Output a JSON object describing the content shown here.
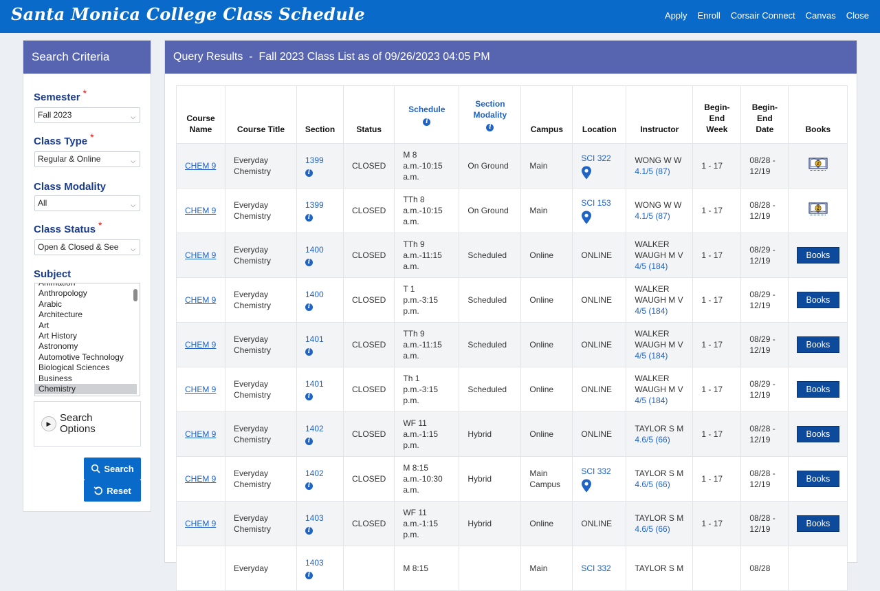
{
  "header": {
    "title": "Santa Monica College Class Schedule",
    "nav": [
      "Apply",
      "Enroll",
      "Corsair Connect",
      "Canvas",
      "Close"
    ]
  },
  "sidebar": {
    "title": "Search Criteria",
    "semester": {
      "label": "Semester",
      "required": "*",
      "value": "Fall 2023"
    },
    "class_type": {
      "label": "Class Type",
      "required": "*",
      "value": "Regular & Online"
    },
    "class_modality": {
      "label": "Class Modality",
      "value": "All"
    },
    "class_status": {
      "label": "Class Status",
      "required": "*",
      "value": "Open & Closed & See"
    },
    "subject": {
      "label": "Subject",
      "items": [
        "Animation",
        "Anthropology",
        "Arabic",
        "Architecture",
        "Art",
        "Art History",
        "Astronomy",
        "Automotive Technology",
        "Biological Sciences",
        "Business",
        "Chemistry"
      ],
      "selected": "Chemistry"
    },
    "search_options_label": "Search Options",
    "search_button": "Search",
    "reset_button": "Reset"
  },
  "results": {
    "title": "Query Results  -  Fall 2023 Class List as of 09/26/2023 04:05 PM",
    "columns": {
      "course_name": "Course Name",
      "course_title": "Course Title",
      "section": "Section",
      "status": "Status",
      "schedule": "Schedule",
      "modality": "Section Modality",
      "campus": "Campus",
      "location": "Location",
      "instructor": "Instructor",
      "begin_end_week": "Begin-End Week",
      "begin_end_date": "Begin-End Date",
      "books": "Books"
    },
    "rows": [
      {
        "course": "CHEM 9",
        "title": "Everyday Chemistry",
        "section": "1399",
        "status": "CLOSED",
        "schedule": "M 8 a.m.-10:15 a.m.",
        "modality": "On Ground",
        "campus": "Main",
        "location": "SCI 322",
        "location_pin": true,
        "instructor": "WONG W W",
        "rating": "4.1/5 (87)",
        "week": "1 - 17",
        "dates": "08/28 - 12/19",
        "books": "icon"
      },
      {
        "course": "CHEM 9",
        "title": "Everyday Chemistry",
        "section": "1399",
        "status": "CLOSED",
        "schedule": "TTh 8 a.m.-10:15 a.m.",
        "modality": "On Ground",
        "campus": "Main",
        "location": "SCI 153",
        "location_pin": true,
        "instructor": "WONG W W",
        "rating": "4.1/5 (87)",
        "week": "1 - 17",
        "dates": "08/28 - 12/19",
        "books": "icon"
      },
      {
        "course": "CHEM 9",
        "title": "Everyday Chemistry",
        "section": "1400",
        "status": "CLOSED",
        "schedule": "TTh 9 a.m.-11:15 a.m.",
        "modality": "Scheduled",
        "campus": "Online",
        "location": "ONLINE",
        "location_pin": false,
        "instructor": "WALKER WAUGH M V",
        "rating": "4/5 (184)",
        "week": "1 - 17",
        "dates": "08/29 - 12/19",
        "books": "Books"
      },
      {
        "course": "CHEM 9",
        "title": "Everyday Chemistry",
        "section": "1400",
        "status": "CLOSED",
        "schedule": "T 1 p.m.-3:15 p.m.",
        "modality": "Scheduled",
        "campus": "Online",
        "location": "ONLINE",
        "location_pin": false,
        "instructor": "WALKER WAUGH M V",
        "rating": "4/5 (184)",
        "week": "1 - 17",
        "dates": "08/29 - 12/19",
        "books": "Books"
      },
      {
        "course": "CHEM 9",
        "title": "Everyday Chemistry",
        "section": "1401",
        "status": "CLOSED",
        "schedule": "TTh 9 a.m.-11:15 a.m.",
        "modality": "Scheduled",
        "campus": "Online",
        "location": "ONLINE",
        "location_pin": false,
        "instructor": "WALKER WAUGH M V",
        "rating": "4/5 (184)",
        "week": "1 - 17",
        "dates": "08/29 - 12/19",
        "books": "Books"
      },
      {
        "course": "CHEM 9",
        "title": "Everyday Chemistry",
        "section": "1401",
        "status": "CLOSED",
        "schedule": "Th 1 p.m.-3:15 p.m.",
        "modality": "Scheduled",
        "campus": "Online",
        "location": "ONLINE",
        "location_pin": false,
        "instructor": "WALKER WAUGH M V",
        "rating": "4/5 (184)",
        "week": "1 - 17",
        "dates": "08/29 - 12/19",
        "books": "Books"
      },
      {
        "course": "CHEM 9",
        "title": "Everyday Chemistry",
        "section": "1402",
        "status": "CLOSED",
        "schedule": "WF 11 a.m.-1:15 p.m.",
        "modality": "Hybrid",
        "campus": "Online",
        "location": "ONLINE",
        "location_pin": false,
        "instructor": "TAYLOR S M",
        "rating": "4.6/5 (66)",
        "week": "1 - 17",
        "dates": "08/28 - 12/19",
        "books": "Books"
      },
      {
        "course": "CHEM 9",
        "title": "Everyday Chemistry",
        "section": "1402",
        "status": "CLOSED",
        "schedule": "M 8:15 a.m.-10:30 a.m.",
        "modality": "Hybrid",
        "campus": "Main Campus",
        "location": "SCI 332",
        "location_pin": true,
        "instructor": "TAYLOR S M",
        "rating": "4.6/5 (66)",
        "week": "1 - 17",
        "dates": "08/28 - 12/19",
        "books": "Books"
      },
      {
        "course": "CHEM 9",
        "title": "Everyday Chemistry",
        "section": "1403",
        "status": "CLOSED",
        "schedule": "WF 11 a.m.-1:15 p.m.",
        "modality": "Hybrid",
        "campus": "Online",
        "location": "ONLINE",
        "location_pin": false,
        "instructor": "TAYLOR S M",
        "rating": "4.6/5 (66)",
        "week": "1 - 17",
        "dates": "08/28 - 12/19",
        "books": "Books"
      },
      {
        "course": "",
        "title": "Everyday",
        "section": "1403",
        "status": "",
        "schedule": "M 8:15",
        "modality": "",
        "campus": "Main",
        "location": "SCI 332",
        "location_pin": false,
        "instructor": "TAYLOR S M",
        "rating": "",
        "week": "",
        "dates": "08/28",
        "books": ""
      }
    ]
  },
  "colors": {
    "topbar": "#0a6ac9",
    "panel_header": "#5765b1",
    "link": "#1f63c4",
    "books_button": "#0d4a9c",
    "required": "#d11111"
  }
}
